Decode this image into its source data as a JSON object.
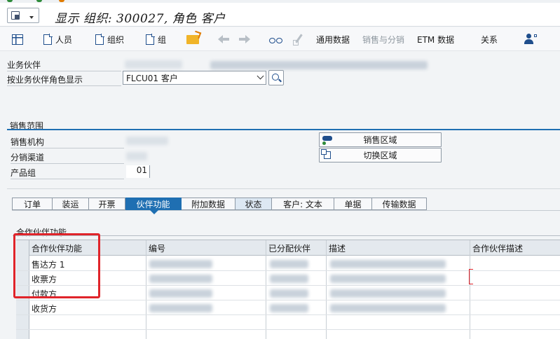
{
  "window": {
    "title": "显示 组织: 300027, 角色 客户"
  },
  "toolbar": {
    "items": [
      {
        "label": "人员",
        "icon": "document-icon"
      },
      {
        "label": "组织",
        "icon": "document-icon"
      },
      {
        "label": "组",
        "icon": "document-icon"
      },
      {
        "label": "通用数据"
      },
      {
        "label": "销售与分销"
      },
      {
        "label": "ETM 数据"
      },
      {
        "label": "关系"
      }
    ]
  },
  "header": {
    "bp_label": "业务伙伴",
    "role_label": "按业务伙伴角色显示",
    "role_value": "FLCU01 客户"
  },
  "sales_area": {
    "title": "销售范围",
    "sales_org_label": "销售机构",
    "dist_channel_label": "分销渠道",
    "division_label": "产品组",
    "division_value": "01",
    "sales_area_button": "销售区域",
    "switch_area_button": "切换区域"
  },
  "tabs": [
    {
      "label": "订单"
    },
    {
      "label": "装运"
    },
    {
      "label": "开票"
    },
    {
      "label": "伙伴功能",
      "active": true
    },
    {
      "label": "附加数据"
    },
    {
      "label": "状态"
    },
    {
      "label": "客户: 文本"
    },
    {
      "label": "单据"
    },
    {
      "label": "传输数据"
    }
  ],
  "partner_functions": {
    "title": "合作伙伴功能",
    "columns": [
      "合作伙伴功能",
      "编号",
      "已分配伙伴",
      "描述",
      "合作伙伴描述"
    ],
    "rows": [
      {
        "function": "售达方 1"
      },
      {
        "function": "收票方"
      },
      {
        "function": "付款方"
      },
      {
        "function": "收货方"
      }
    ]
  },
  "colors": {
    "accent": "#1f6fb2",
    "highlight_box": "#e0242a"
  }
}
